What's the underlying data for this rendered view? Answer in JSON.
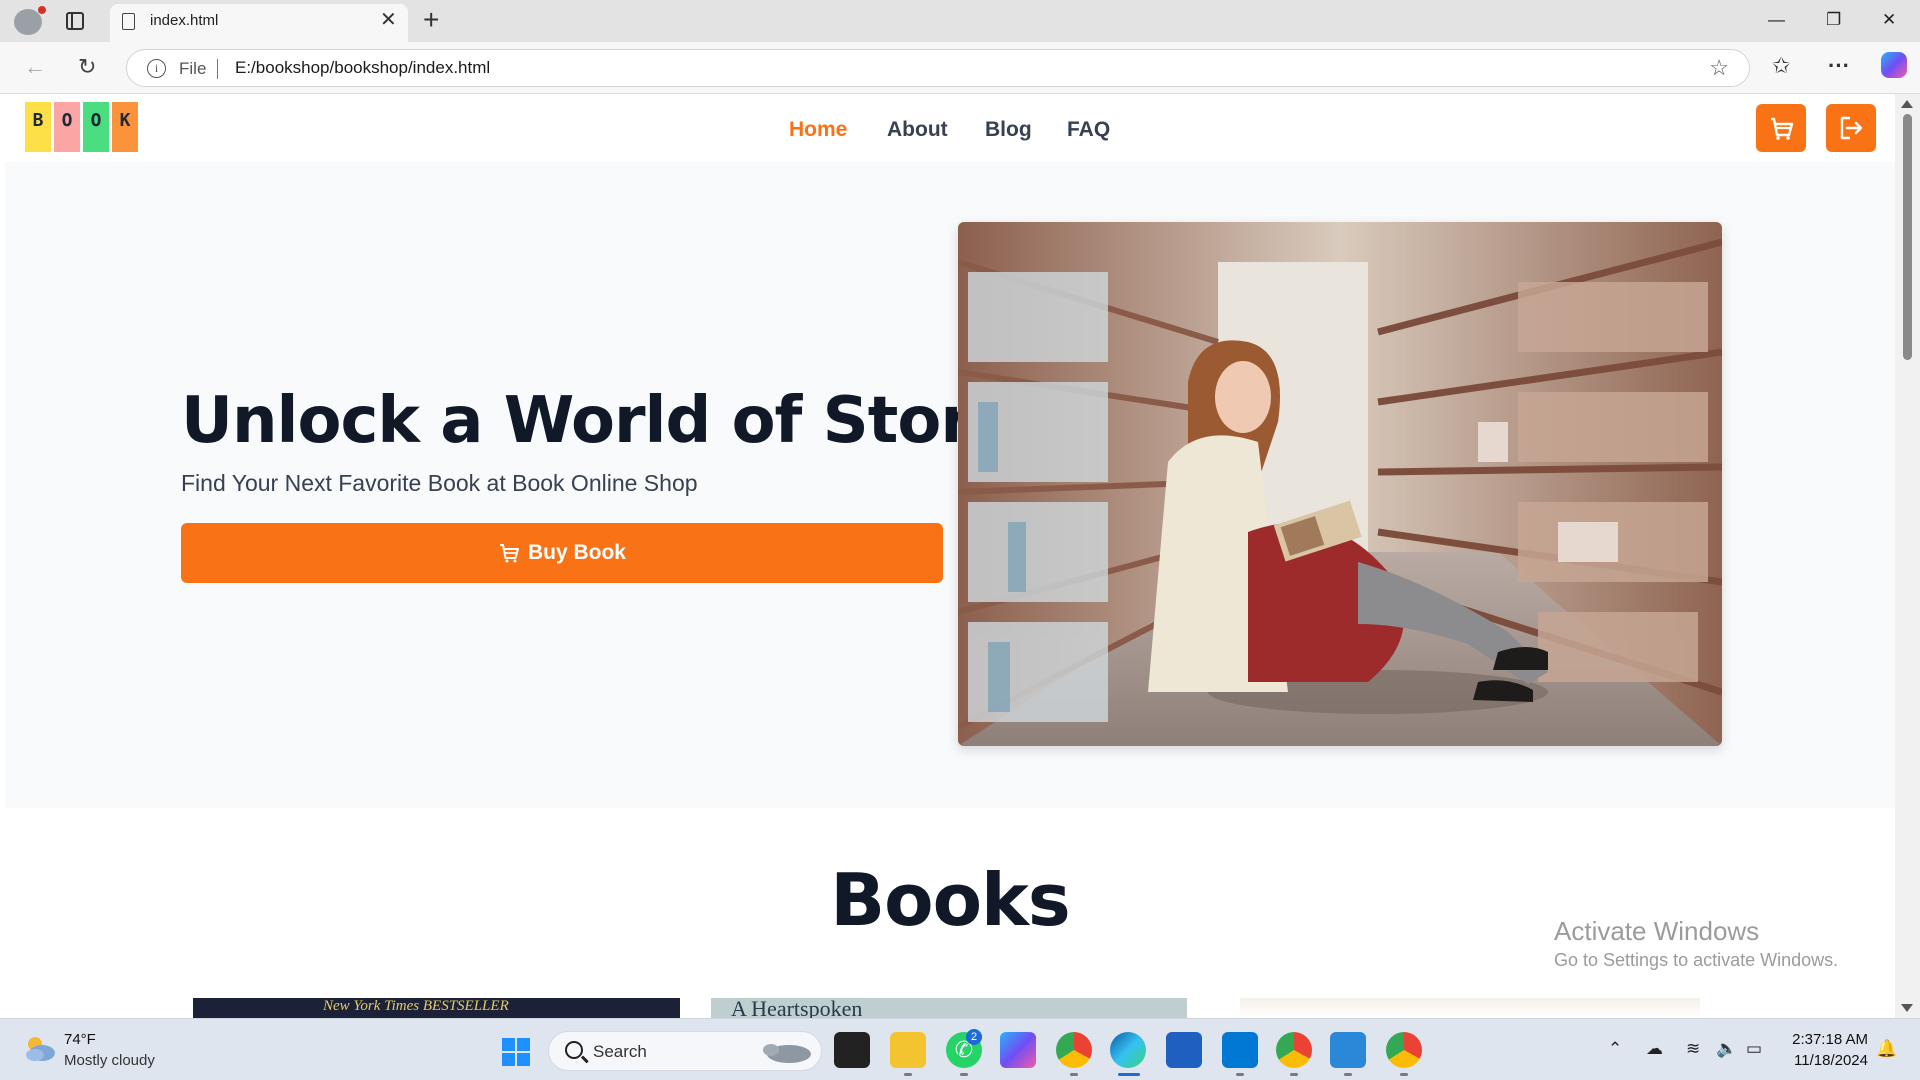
{
  "browser": {
    "tab_title": "index.html",
    "address_scheme": "File",
    "address_url": "E:/bookshop/bookshop/index.html"
  },
  "site": {
    "logo_letters": [
      "B",
      "O",
      "O",
      "K"
    ],
    "logo_colors": [
      "#fde047",
      "#fca5a5",
      "#4ade80",
      "#fb923c"
    ],
    "nav": [
      {
        "label": "Home",
        "active": true
      },
      {
        "label": "About",
        "active": false
      },
      {
        "label": "Blog",
        "active": false
      },
      {
        "label": "FAQ",
        "active": false
      }
    ],
    "accent_color": "#f97316",
    "hero": {
      "title": "Unlock a World of Stories",
      "subtitle": "Find Your Next Favorite Book at Book Online Shop",
      "button_label": "Buy Book",
      "image": "woman-reading-in-library-photo"
    },
    "books_heading": "Books",
    "book_cover_texts": [
      "New York Times BESTSELLER",
      "A Heartspoken"
    ]
  },
  "watermark": {
    "line1": "Activate Windows",
    "line2": "Go to Settings to activate Windows."
  },
  "taskbar": {
    "weather_temp": "74°F",
    "weather_desc": "Mostly cloudy",
    "search_placeholder": "Search",
    "whatsapp_badge": "2",
    "clock_time": "2:37:18 AM",
    "clock_date": "11/18/2024"
  }
}
